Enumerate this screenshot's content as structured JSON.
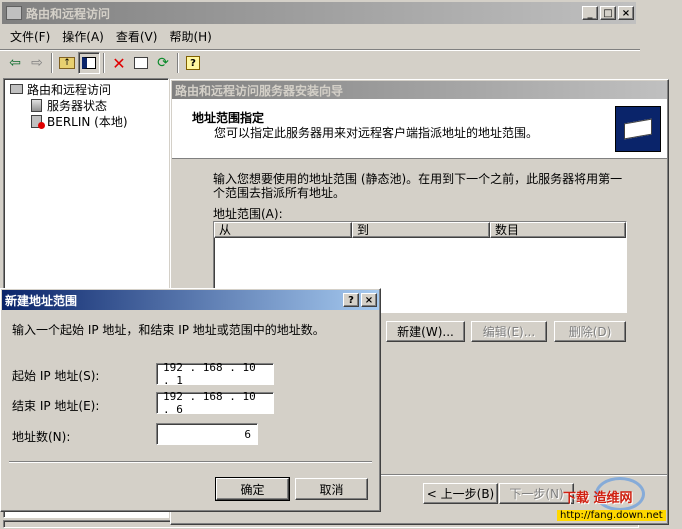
{
  "main_window": {
    "title": "路由和远程访问",
    "caption_buttons": [
      "_",
      "□",
      "×"
    ],
    "menu": [
      "文件(F)",
      "操作(A)",
      "查看(V)",
      "帮助(H)"
    ],
    "toolbar_icons": [
      "back-icon",
      "forward-icon",
      "up-folder-icon",
      "show-tree-icon",
      "delete-icon",
      "properties-icon",
      "refresh-icon",
      "help-icon"
    ]
  },
  "tree": {
    "root": "路由和远程访问",
    "children": [
      "服务器状态",
      "BERLIN (本地)"
    ]
  },
  "wizard": {
    "title": "路由和远程访问服务器安装向导",
    "header_title": "地址范围指定",
    "header_subtitle": "您可以指定此服务器用来对远程客户端指派地址的地址范围。",
    "description_line1": "输入您想要使用的地址范围 (静态池)。在用到下一个之前，此服务器将用第一",
    "description_line2": "个范围去指派所有地址。",
    "list_label": "地址范围(A):",
    "columns": [
      "从",
      "到",
      "数目"
    ],
    "buttons": {
      "new": "新建(W)...",
      "edit": "编辑(E)...",
      "delete": "删除(D)"
    },
    "nav": {
      "back": "< 上一步(B)",
      "next": "下一步(N)"
    }
  },
  "dialog": {
    "title": "新建地址范围",
    "caption_buttons": [
      "?",
      "×"
    ],
    "instruction": "输入一个起始 IP 地址，和结束 IP 地址或范围中的地址数。",
    "start_label": "起始 IP 地址(S):",
    "start_value": "192 . 168 . 10 . 1",
    "end_label": "结束 IP 地址(E):",
    "end_value": "192 . 168 . 10 . 6",
    "count_label": "地址数(N):",
    "count_value": "6",
    "ok": "确定",
    "cancel": "取消"
  },
  "watermark": {
    "line1": "下载 造维网",
    "line2": "http://fang.down.net"
  },
  "colors": {
    "titlebar_active": "#0a246a",
    "face": "#d4d0c8",
    "window": "#ffffff"
  }
}
